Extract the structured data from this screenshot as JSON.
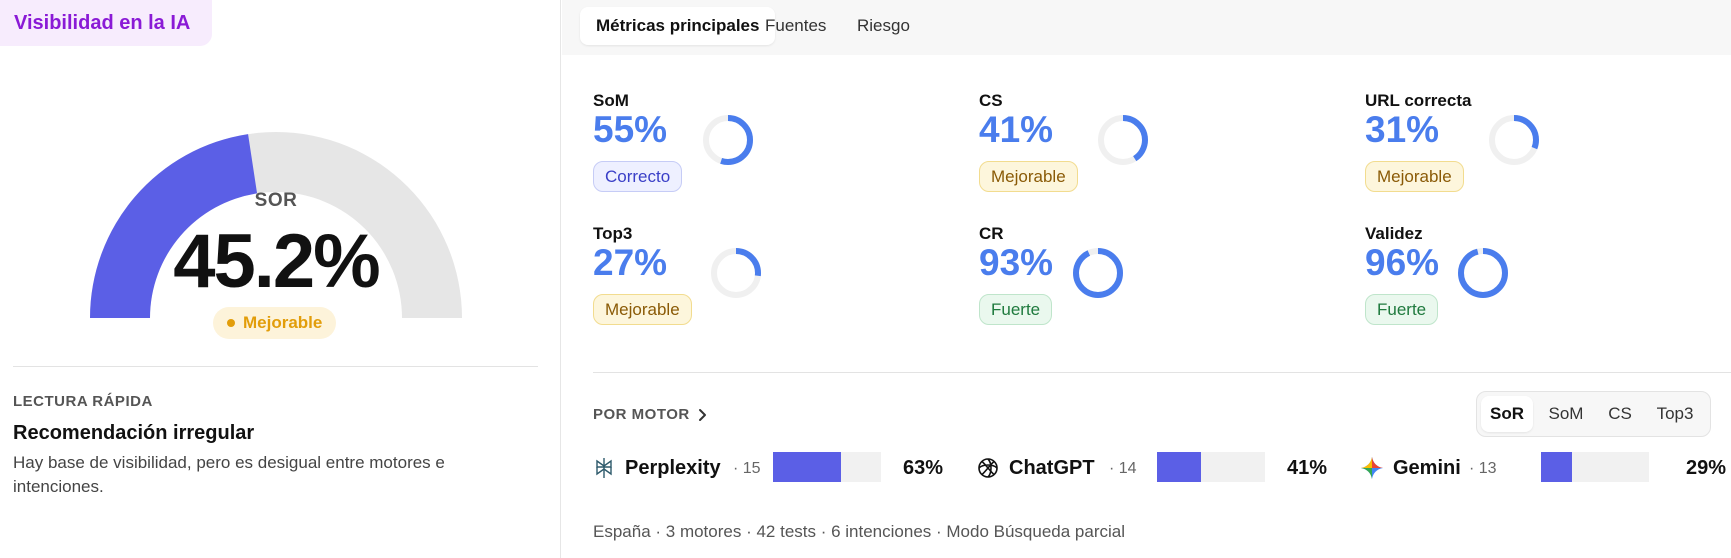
{
  "header": {
    "title": "Visibilidad en la IA"
  },
  "gauge": {
    "label": "SOR",
    "value_text": "45.2%",
    "value": 45.2,
    "status": "Mejorable"
  },
  "quick_read": {
    "label": "LECTURA RÁPIDA",
    "title": "Recomendación irregular",
    "text": "Hay base de visibilidad, pero es desigual entre motores e intenciones."
  },
  "tabs": [
    {
      "label": "Métricas principales",
      "active": true
    },
    {
      "label": "Fuentes",
      "active": false
    },
    {
      "label": "Riesgo",
      "active": false
    }
  ],
  "metrics": [
    {
      "name": "SoM",
      "pct_text": "55%",
      "value": 55,
      "badge": "Correcto",
      "level": "correcto"
    },
    {
      "name": "CS",
      "pct_text": "41%",
      "value": 41,
      "badge": "Mejorable",
      "level": "mejorable"
    },
    {
      "name": "URL correcta",
      "pct_text": "31%",
      "value": 31,
      "badge": "Mejorable",
      "level": "mejorable"
    },
    {
      "name": "Top3",
      "pct_text": "27%",
      "value": 27,
      "badge": "Mejorable",
      "level": "mejorable"
    },
    {
      "name": "CR",
      "pct_text": "93%",
      "value": 93,
      "badge": "Fuerte",
      "level": "fuerte"
    },
    {
      "name": "Validez",
      "pct_text": "96%",
      "value": 96,
      "badge": "Fuerte",
      "level": "fuerte"
    }
  ],
  "engines_section": {
    "label": "POR MOTOR",
    "segments": [
      {
        "label": "SoR",
        "active": true
      },
      {
        "label": "SoM",
        "active": false
      },
      {
        "label": "CS",
        "active": false
      },
      {
        "label": "Top3",
        "active": false
      }
    ],
    "engines": [
      {
        "name": "Perplexity",
        "count": "· 15",
        "pct_text": "63%",
        "value": 63,
        "icon": "perplexity-icon"
      },
      {
        "name": "ChatGPT",
        "count": "· 14",
        "pct_text": "41%",
        "value": 41,
        "icon": "chatgpt-icon"
      },
      {
        "name": "Gemini",
        "count": "· 13",
        "pct_text": "29%",
        "value": 29,
        "icon": "gemini-icon"
      }
    ]
  },
  "footer": {
    "text": "España · 3 motores · 42 tests · 6 intenciones · Modo Búsqueda parcial"
  },
  "colors": {
    "accent": "#4a7ded",
    "gauge_fill": "#5b5fe6",
    "gauge_track": "#e6e6e6",
    "title": "#8a1ad6"
  }
}
